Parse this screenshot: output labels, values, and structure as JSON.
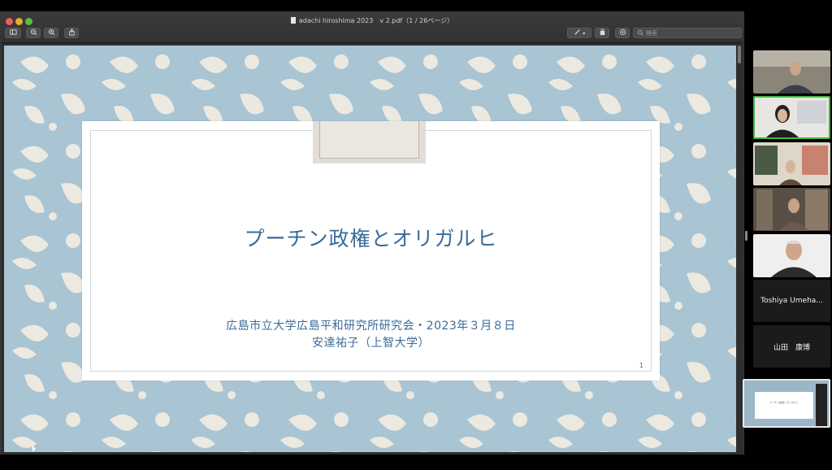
{
  "window": {
    "title": "adachi hiroshima 2023　v 2.pdf（1 / 26ページ）"
  },
  "toolbar": {
    "search_placeholder": "検索",
    "buttons": [
      {
        "name": "sidebar-toggle",
        "icon": "sidebar-icon"
      },
      {
        "name": "zoom-out",
        "icon": "zoom-out-icon"
      },
      {
        "name": "zoom-in",
        "icon": "zoom-in-icon"
      },
      {
        "name": "share",
        "icon": "share-icon"
      },
      {
        "name": "markup",
        "icon": "pen-icon"
      },
      {
        "name": "rotate",
        "icon": "rotate-icon"
      },
      {
        "name": "annotate",
        "icon": "markup-circle-icon"
      }
    ]
  },
  "slide": {
    "title": "プーチン政権とオリガルヒ",
    "subtitle_line1": "広島市立大学広島平和研究所研究会・2023年３月８日",
    "subtitle_line2": "安達祐子（上智大学）",
    "page_number": "1"
  },
  "gallery": {
    "participants": [
      {
        "type": "video",
        "label": "participant-1"
      },
      {
        "type": "video",
        "label": "participant-2",
        "active": true
      },
      {
        "type": "video",
        "label": "participant-3"
      },
      {
        "type": "video",
        "label": "participant-4"
      },
      {
        "type": "video",
        "label": "participant-5"
      },
      {
        "type": "name",
        "name": "Toshiya Umeha..."
      },
      {
        "type": "name",
        "name": "山田　康博"
      }
    ],
    "share_preview_title": "プーチン政権とオリガルヒ"
  },
  "colors": {
    "accent_title": "#3a6b98",
    "slide_bg": "#a9c4d3",
    "active_speaker": "#40b840"
  }
}
